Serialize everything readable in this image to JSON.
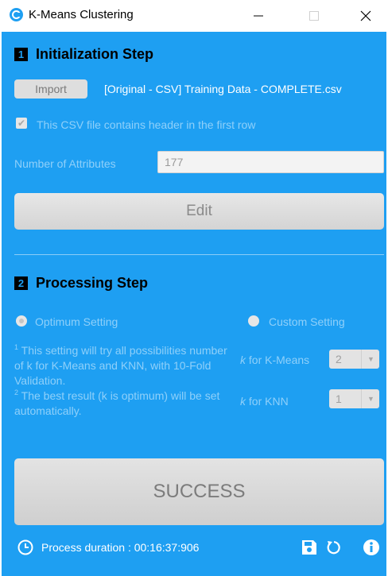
{
  "window": {
    "title": "K-Means Clustering",
    "controls": [
      "minimize",
      "maximize",
      "close"
    ]
  },
  "initialization": {
    "step_number": "1",
    "heading": "Initialization Step",
    "import_button": "Import",
    "file_label": "[Original - CSV] Training Data - COMPLETE.csv",
    "header_checkbox_label": "This CSV file contains header in the first row",
    "header_checked": true,
    "attributes_label": "Number of Attributes",
    "attributes_value": "177",
    "edit_button": "Edit"
  },
  "processing": {
    "step_number": "2",
    "heading": "Processing Step",
    "option_optimum": "Optimum Setting",
    "option_custom": "Custom Setting",
    "selected_option": "Optimum Setting",
    "note1_sup": "1",
    "note1_text": "This setting will try all possibilities number of k for K-Means and KNN, with 10-Fold Validation.",
    "note2_sup": "2",
    "note2_text": "The best result (k is optimum) will be set automatically.",
    "k_kmeans_label": "for K-Means",
    "k_kmeans_value": "2",
    "k_knn_label": "for KNN",
    "k_knn_value": "1",
    "k_symbol": "k"
  },
  "result": {
    "button": "SUCCESS",
    "duration_text": "Process duration : 00:16:37:906"
  },
  "colors": {
    "background": "#1e9ff2",
    "disabled_text": "#8fd0fa"
  }
}
